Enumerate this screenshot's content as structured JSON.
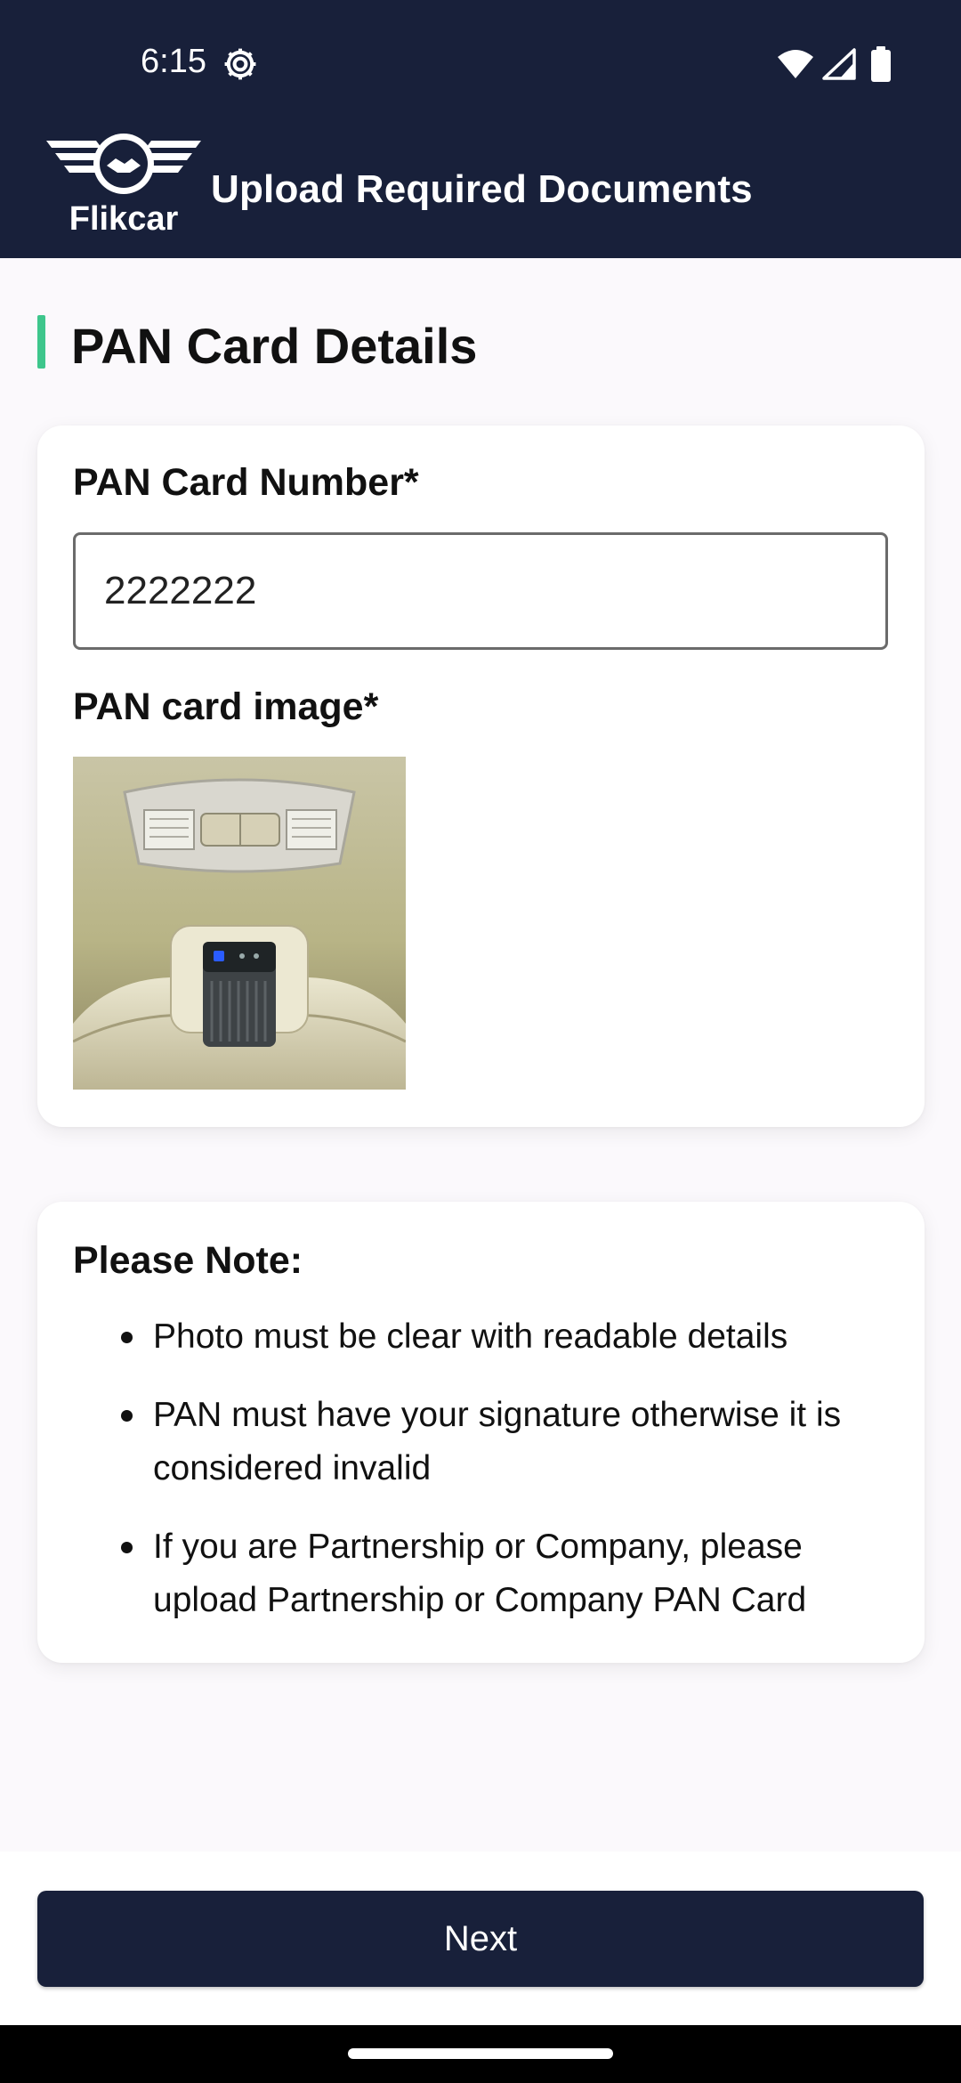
{
  "status_bar": {
    "time": "6:15",
    "icons": [
      "settings-gear-icon",
      "wifi-icon",
      "cell-signal-icon",
      "battery-icon"
    ]
  },
  "app_bar": {
    "logo_text": "Flikcar",
    "title": "Upload Required Documents"
  },
  "section": {
    "title": "PAN Card Details",
    "accent_color": "#3ec68c"
  },
  "form": {
    "pan_number_label": "PAN Card Number*",
    "pan_number_value": "2222222",
    "pan_image_label": "PAN card image*"
  },
  "note": {
    "title": "Please Note:",
    "items": [
      "Photo must be clear with readable details",
      "PAN must have your signature otherwise it is considered invalid",
      "If you are Partnership or Company, please upload Partnership or Company PAN Card"
    ]
  },
  "actions": {
    "next_label": "Next"
  },
  "colors": {
    "primary_dark": "#18203a",
    "background": "#fbf9fc"
  }
}
